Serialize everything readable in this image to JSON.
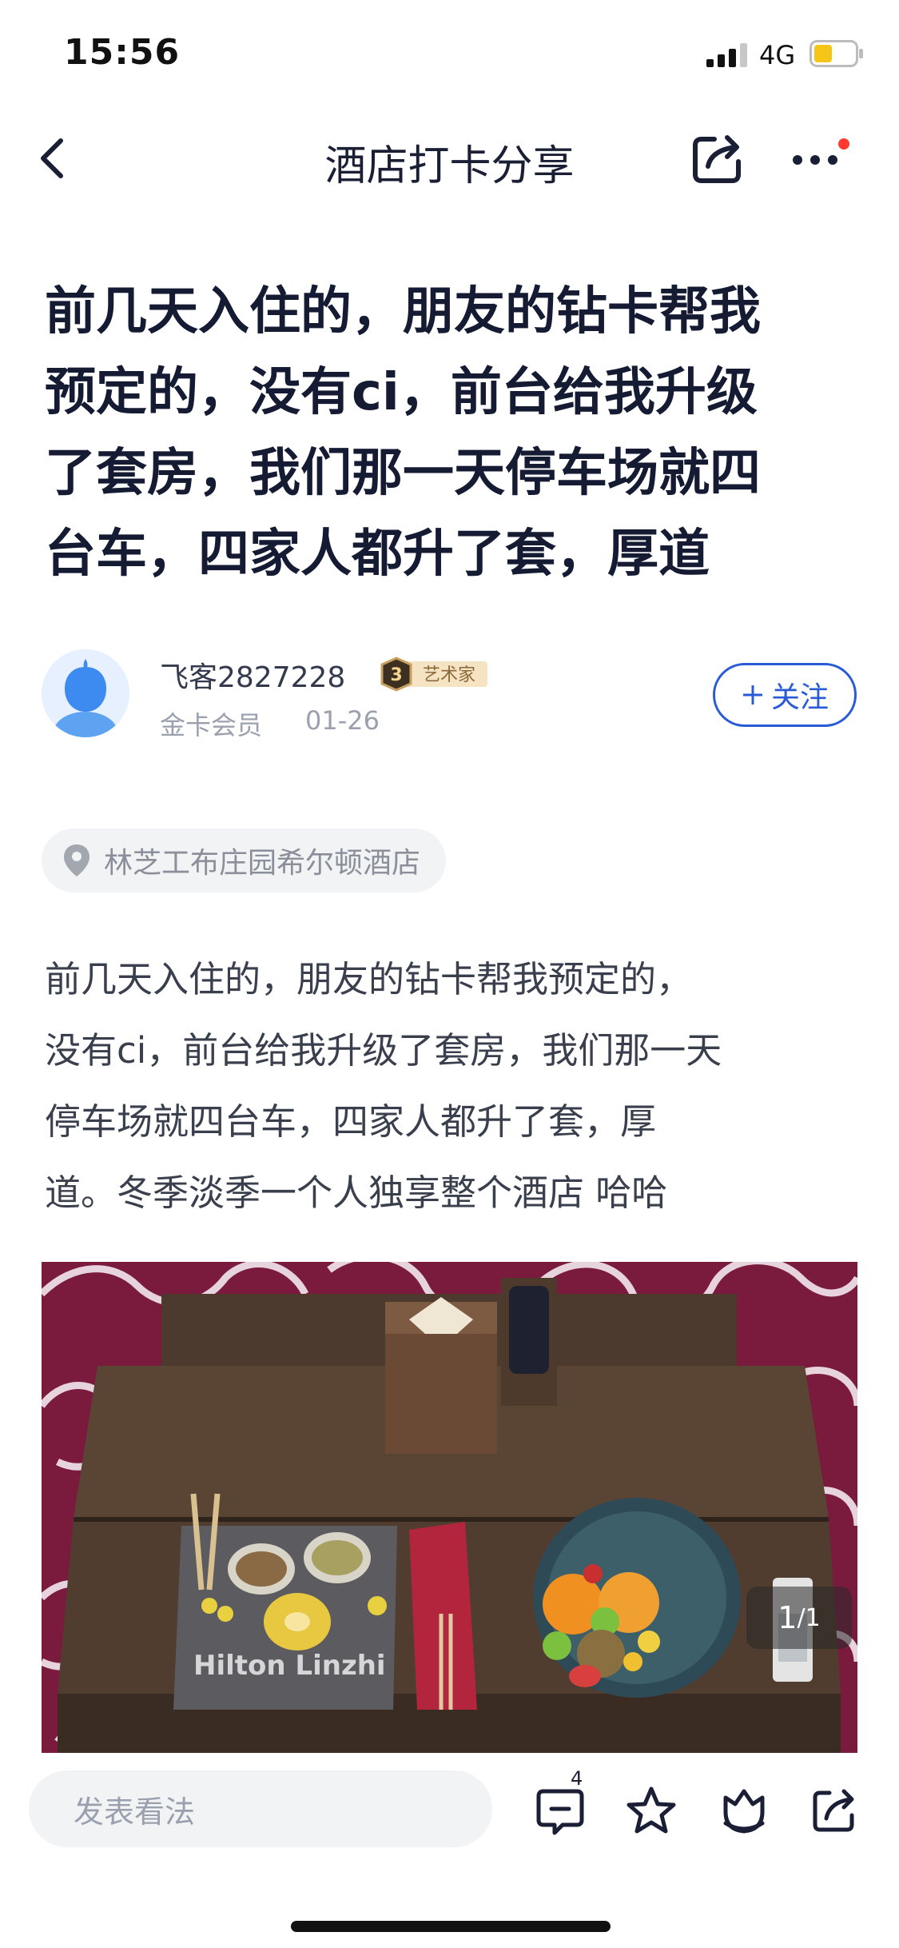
{
  "status_bar": {
    "time": "15:56",
    "network": "4G",
    "battery_color": "#f5c518"
  },
  "nav": {
    "title": "酒店打卡分享",
    "notification_dot_color": "#ff3b30"
  },
  "post": {
    "title_lines": [
      "前几天入住的，朋友的钻卡帮我",
      "预定的，没有ci，前台给我升级",
      "了套房，我们那一天停车场就四",
      "台车，四家人都升了套，厚道"
    ],
    "author": {
      "name": "飞客2827228",
      "badge_level": "3",
      "badge_label": "艺术家",
      "member_level": "金卡会员",
      "date": "01-26"
    },
    "follow_label": "关注",
    "follow_icon": "plus-icon",
    "location": "林芝工布庄园希尔顿酒店",
    "body_lines": [
      "前几天入住的，朋友的钻卡帮我预定的，",
      "没有ci，前台给我升级了套房，我们那一天",
      "停车场就四台车，四家人都升了套，厚",
      "道。冬季淡季一个人独享整个酒店 哈哈"
    ],
    "photo": {
      "board_text": "Hilton Linzhi",
      "counter_current": "1",
      "counter_total": "/1"
    }
  },
  "bottom_bar": {
    "comment_placeholder": "发表看法",
    "comment_count": "4",
    "icons": [
      "comment-icon",
      "star-icon",
      "like-icon",
      "share-icon"
    ]
  },
  "colors": {
    "accent": "#2a5bd7",
    "title": "#141b33",
    "carpet": "#7a1b3e"
  }
}
